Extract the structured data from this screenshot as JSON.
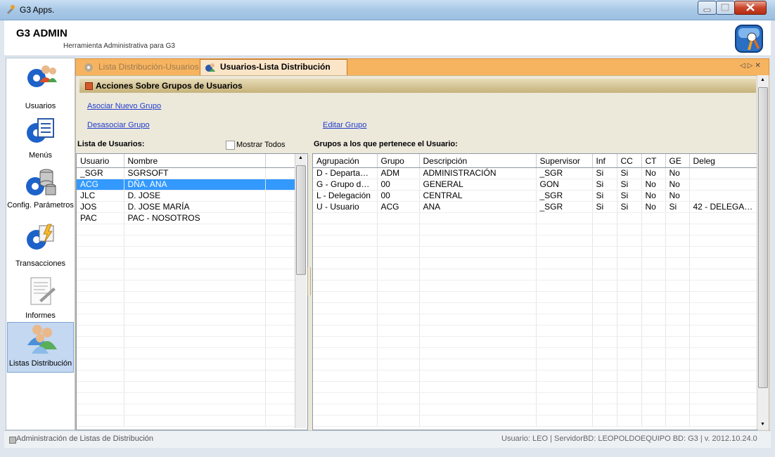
{
  "window": {
    "title": "G3 Apps."
  },
  "header": {
    "app_name": "G3 ADMIN",
    "subtitle": "Herramienta Administrativa para G3"
  },
  "sidebar": {
    "items": [
      {
        "label": "Usuarios",
        "icon": "users-gear-icon"
      },
      {
        "label": "Menús",
        "icon": "menu-gear-icon"
      },
      {
        "label": "Config. Parámetros",
        "icon": "database-gear-icon"
      },
      {
        "label": "Transacciones",
        "icon": "transactions-gear-icon"
      },
      {
        "label": "Informes",
        "icon": "report-document-icon"
      },
      {
        "label": "Listas Distribución",
        "icon": "distribution-users-icon",
        "active": true
      }
    ]
  },
  "tabs": [
    {
      "label": "Lista Distribución-Usuarios",
      "active": false
    },
    {
      "label": "Usuarios-Lista Distribución",
      "active": true
    }
  ],
  "section": {
    "title": "Acciones Sobre Grupos de Usuarios"
  },
  "actions": {
    "asociar": "Asociar Nuevo Grupo",
    "desasociar": "Desasociar Grupo",
    "editar": "Editar Grupo"
  },
  "users_panel": {
    "title": "Lista de Usuarios:",
    "show_all_label": "Mostrar Todos",
    "columns": [
      "Usuario",
      "Nombre"
    ],
    "rows": [
      [
        "_SGR",
        "SGRSOFT"
      ],
      [
        "ACG",
        "DÑA. ANA"
      ],
      [
        "JLC",
        "D. JOSE"
      ],
      [
        "JOS",
        "D. JOSE MARÍA"
      ],
      [
        "PAC",
        "PAC - NOSOTROS"
      ]
    ],
    "selected_row": 1
  },
  "groups_panel": {
    "title": "Grupos a los que pertenece el Usuario:",
    "columns": [
      "Agrupación",
      "Grupo",
      "Descripción",
      "Supervisor",
      "Inf",
      "CC",
      "CT",
      "GE",
      "Deleg"
    ],
    "rows": [
      [
        "D - Departam...",
        "ADM",
        "ADMINISTRACIÓN",
        "_SGR",
        "Si",
        "Si",
        "No",
        "No",
        ""
      ],
      [
        "G - Grupo de ...",
        "00",
        "GENERAL",
        "GON",
        "Si",
        "Si",
        "No",
        "No",
        ""
      ],
      [
        "L - Delegación",
        "00",
        "CENTRAL",
        "_SGR",
        "Si",
        "Si",
        "No",
        "No",
        ""
      ],
      [
        "U - Usuario",
        "ACG",
        "ANA",
        "_SGR",
        "Si",
        "Si",
        "No",
        "Si",
        "42 - DELEGACIO"
      ]
    ]
  },
  "status": {
    "left": "Administración de Listas de Distribución",
    "right": "Usuario: LEO  |  ServidorBD: LEOPOLDOEQUIPO  BD: G3  |  v. 2012.10.24.0"
  },
  "colors": {
    "tab_strip": "#f7b460",
    "selection": "#3399ff",
    "link": "#1f3ccc"
  }
}
